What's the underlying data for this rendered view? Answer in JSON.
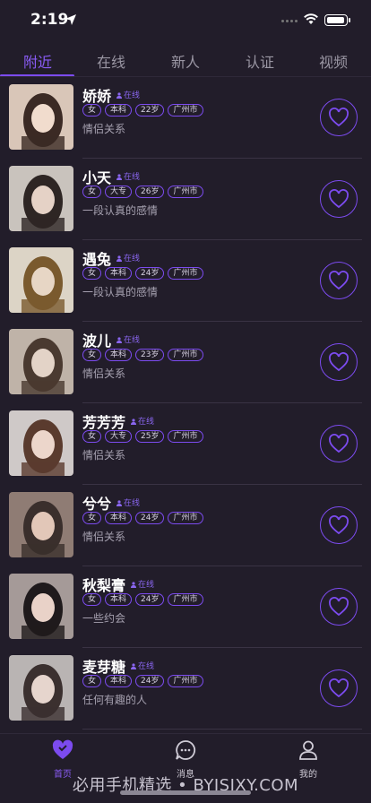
{
  "status": {
    "time": "2:19"
  },
  "tabs": [
    {
      "label": "附近"
    },
    {
      "label": "在线"
    },
    {
      "label": "新人"
    },
    {
      "label": "认证"
    },
    {
      "label": "视频"
    }
  ],
  "online_label": "在线",
  "users": [
    {
      "name": "娇娇",
      "tags": [
        "女",
        "本科",
        "22岁",
        "广州市"
      ],
      "desc": "情侣关系"
    },
    {
      "name": "小天",
      "tags": [
        "女",
        "大专",
        "26岁",
        "广州市"
      ],
      "desc": "一段认真的感情"
    },
    {
      "name": "遇兔",
      "tags": [
        "女",
        "本科",
        "24岁",
        "广州市"
      ],
      "desc": "一段认真的感情"
    },
    {
      "name": "波儿",
      "tags": [
        "女",
        "本科",
        "23岁",
        "广州市"
      ],
      "desc": "情侣关系"
    },
    {
      "name": "芳芳芳",
      "tags": [
        "女",
        "大专",
        "25岁",
        "广州市"
      ],
      "desc": "情侣关系"
    },
    {
      "name": "兮兮",
      "tags": [
        "女",
        "本科",
        "24岁",
        "广州市"
      ],
      "desc": "情侣关系"
    },
    {
      "name": "秋梨膏",
      "tags": [
        "女",
        "本科",
        "24岁",
        "广州市"
      ],
      "desc": "一些约会"
    },
    {
      "name": "麦芽糖",
      "tags": [
        "女",
        "本科",
        "24岁",
        "广州市"
      ],
      "desc": "任何有趣的人"
    }
  ],
  "tabbar": [
    {
      "label": "首页"
    },
    {
      "label": "消息"
    },
    {
      "label": "我的"
    }
  ],
  "watermark": "必用手机精选 • BYJSJXY.COM",
  "colors": {
    "accent": "#7c4bef",
    "background": "#221d2a"
  }
}
